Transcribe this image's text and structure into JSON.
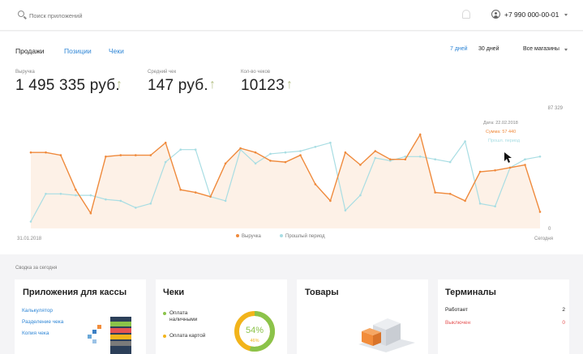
{
  "header": {
    "search_placeholder": "Поиск приложений",
    "phone": "+7 990 000-00-01"
  },
  "tabs": [
    {
      "label": "Продажи",
      "active": true
    },
    {
      "label": "Позиции",
      "active": false
    },
    {
      "label": "Чеки",
      "active": false
    }
  ],
  "period": {
    "seven_days": "7 дней",
    "thirty_days": "30 дней",
    "selected": "7 дней"
  },
  "store_select": "Все магазины",
  "kpis": [
    {
      "label": "Выручка",
      "value": "1 495 335 руб."
    },
    {
      "label": "Средний чек",
      "value": "147 руб."
    },
    {
      "label": "Кол-во чеков",
      "value": "10123"
    }
  ],
  "chart_data": {
    "type": "area",
    "x_start_label": "31.01.2018",
    "x_end_label": "Сегодня",
    "y_max_label": "87 329",
    "y_min_label": "0",
    "ylim": [
      0,
      87329
    ],
    "series": [
      {
        "name": "Выручка",
        "color": "#ef8a3c",
        "values": [
          55000,
          55000,
          53000,
          28000,
          11000,
          52000,
          53000,
          53000,
          53000,
          62000,
          28000,
          26000,
          23000,
          47000,
          58000,
          55000,
          49000,
          48000,
          53000,
          32000,
          20000,
          55000,
          46000,
          56000,
          50000,
          50000,
          68000,
          26000,
          25000,
          20000,
          41000,
          42000,
          44000,
          46000,
          12000
        ]
      },
      {
        "name": "Прошлый период",
        "color": "#a8dde3",
        "values": [
          5000,
          25000,
          25000,
          24000,
          24000,
          21000,
          20000,
          15000,
          18000,
          48000,
          57000,
          57000,
          23000,
          20000,
          57000,
          47000,
          54000,
          55000,
          56000,
          59000,
          62000,
          13000,
          24000,
          51000,
          49000,
          52000,
          52000,
          50000,
          48000,
          63000,
          18000,
          16000,
          44000,
          50000,
          52000
        ]
      }
    ]
  },
  "tooltip": {
    "date": "Дата: 22.02.2018",
    "sum": "Сумма: 57 440",
    "prev": "Прошл. период"
  },
  "summary_label": "Сводка за сегодня",
  "cards": {
    "apps": {
      "title": "Приложения для кассы",
      "links": [
        "Калькулятор",
        "Разделение чека",
        "Копия чека"
      ]
    },
    "checks": {
      "title": "Чеки",
      "cash": "Оплата наличными",
      "card": "Оплата картой",
      "percent": "54%",
      "percent_sub": "46%",
      "cash_color": "#8bc34a",
      "card_color": "#f2b41b"
    },
    "goods": {
      "title": "Товары"
    },
    "terminals": {
      "title": "Терминалы",
      "rows": [
        {
          "label": "Работает",
          "value": "2"
        },
        {
          "label": "Выключен",
          "value": "0"
        }
      ]
    }
  }
}
